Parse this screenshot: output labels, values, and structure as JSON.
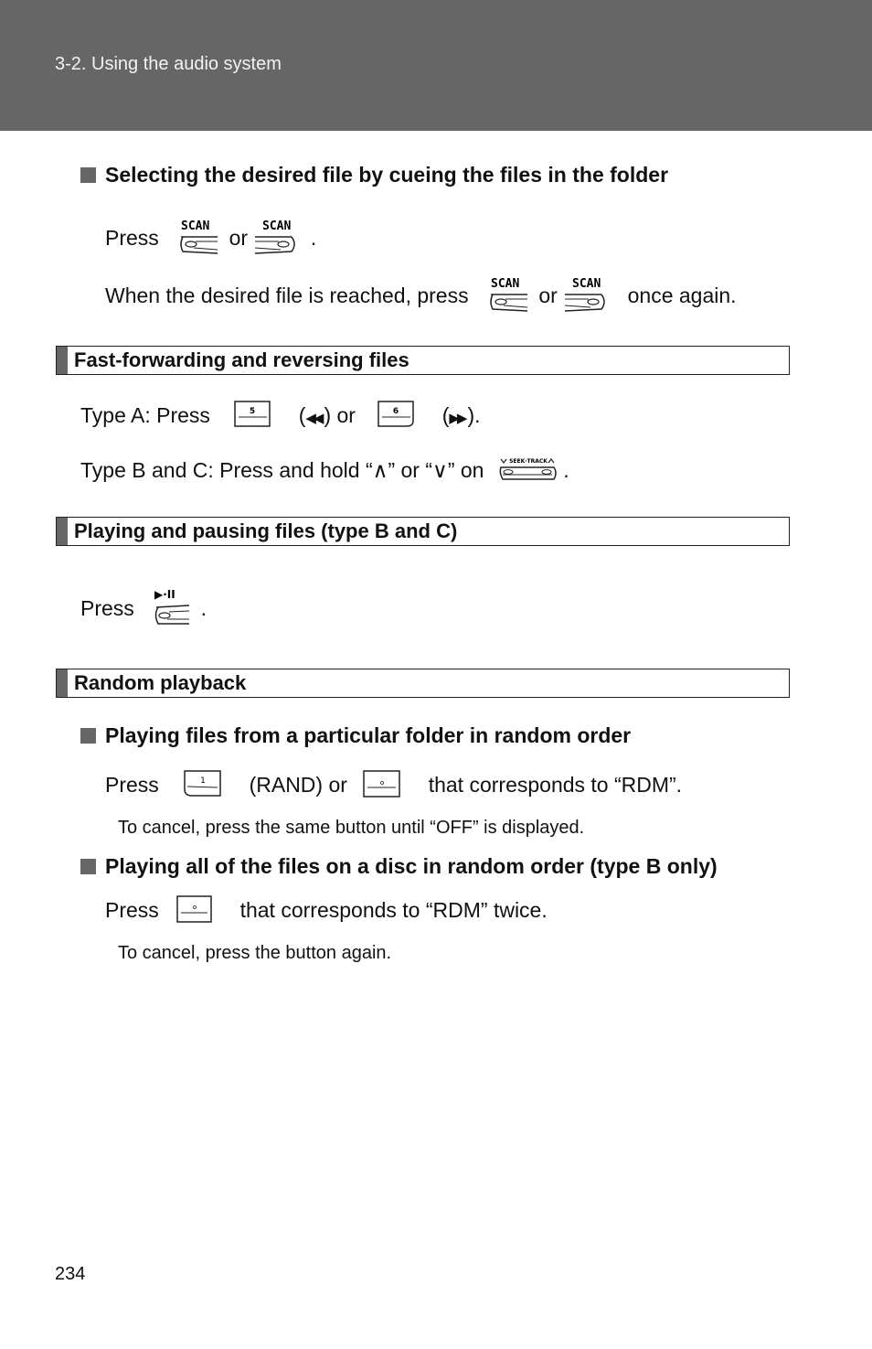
{
  "header": {
    "breadcrumb": "3-2. Using the audio system"
  },
  "section_select": {
    "heading": "Selecting the desired file by cueing the files in the folder",
    "line1": {
      "press": "Press",
      "or": "or",
      "end": "."
    },
    "line2": {
      "prefix": "When the desired file is reached, press",
      "or": "or",
      "suffix": "once again."
    },
    "icons": {
      "scan_label": "SCAN",
      "scan_left": "scan-button-left-icon",
      "scan_right": "scan-button-right-icon"
    }
  },
  "section_ff": {
    "title": "Fast-forwarding and reversing files",
    "type_a": {
      "prefix": "Type A: Press",
      "rev_open": "(",
      "rev_close": ") or",
      "ff_open": "(",
      "ff_close": ").",
      "btn5": "5",
      "btn6": "6",
      "rev_symbol": "◀◀",
      "ff_symbol": "▶▶"
    },
    "type_bc": {
      "text": "Type B and C: Press and hold “∧” or “∨” on",
      "end": ".",
      "seek_label": "SEEK·TRACK"
    }
  },
  "section_play": {
    "title": "Playing and pausing files (type B and C)",
    "line": {
      "press": "Press",
      "end": "."
    },
    "play_pause_label": "▶·II"
  },
  "section_random": {
    "title": "Random playback",
    "folder": {
      "heading": "Playing files from a particular folder in random order",
      "press": "Press",
      "rand": "(RAND) or",
      "suffix": "that corresponds to “RDM”.",
      "note": "To cancel, press the same button until “OFF” is displayed.",
      "btn1": "1"
    },
    "disc": {
      "heading": "Playing all of the files on a disc in random order (type B only)",
      "press": "Press",
      "suffix": "that corresponds to “RDM” twice.",
      "note": "To cancel, press the button again."
    }
  },
  "footer": {
    "page_number": "234"
  }
}
